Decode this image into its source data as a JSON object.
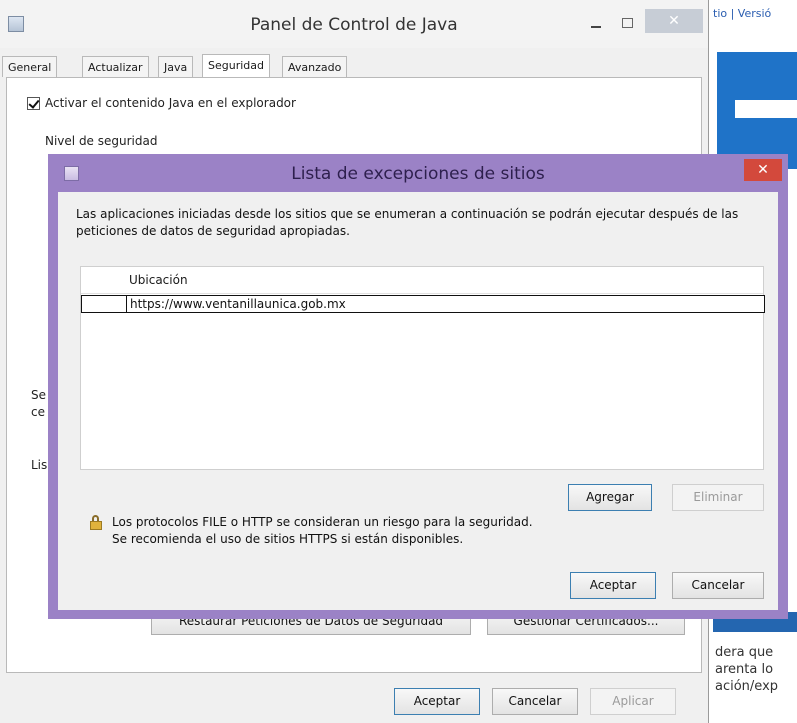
{
  "main_window": {
    "title": "Panel de Control de Java",
    "close_glyph": "✕",
    "tabs": [
      {
        "label": "General"
      },
      {
        "label": "Actualizar"
      },
      {
        "label": "Java"
      },
      {
        "label": "Seguridad",
        "active": true
      },
      {
        "label": "Avanzado"
      }
    ],
    "enable_java_label": "Activar el contenido Java en el explorador",
    "enable_java_checked": true,
    "security_level_label": "Nivel de seguridad",
    "partial_left_text_1": "Se",
    "partial_left_text_2": "ce",
    "partial_left_text_3": "Lis",
    "btn_restore_prompts": "Restaurar Peticiones de Datos de Seguridad",
    "btn_manage_certs": "Gestionar Certificados...",
    "btn_accept": "Aceptar",
    "btn_cancel": "Cancelar",
    "btn_apply": "Aplicar"
  },
  "dialog": {
    "title": "Lista de excepciones de sitios",
    "close_glyph": "✕",
    "description": "Las aplicaciones iniciadas desde los sitios que se enumeran a continuación se podrán ejecutar después de las peticiones de datos de seguridad apropiadas.",
    "table": {
      "column_header": "Ubicación",
      "rows": [
        "https://www.ventanillaunica.gob.mx"
      ]
    },
    "btn_add": "Agregar",
    "btn_remove": "Eliminar",
    "warning_line_1": "Los protocolos FILE o HTTP se consideran un riesgo para la seguridad.",
    "warning_line_2": "Se recomienda el uso de sitios HTTPS si están disponibles.",
    "btn_accept": "Aceptar",
    "btn_cancel": "Cancelar"
  },
  "background_page": {
    "top_links": "tio | Versió",
    "text_lines": [
      "dera que",
      "arenta lo",
      "ación/exp"
    ]
  },
  "colors": {
    "dialog_frame": "#9b82c6",
    "close_button": "#d3493c",
    "browser_banner": "#1f73c8"
  }
}
